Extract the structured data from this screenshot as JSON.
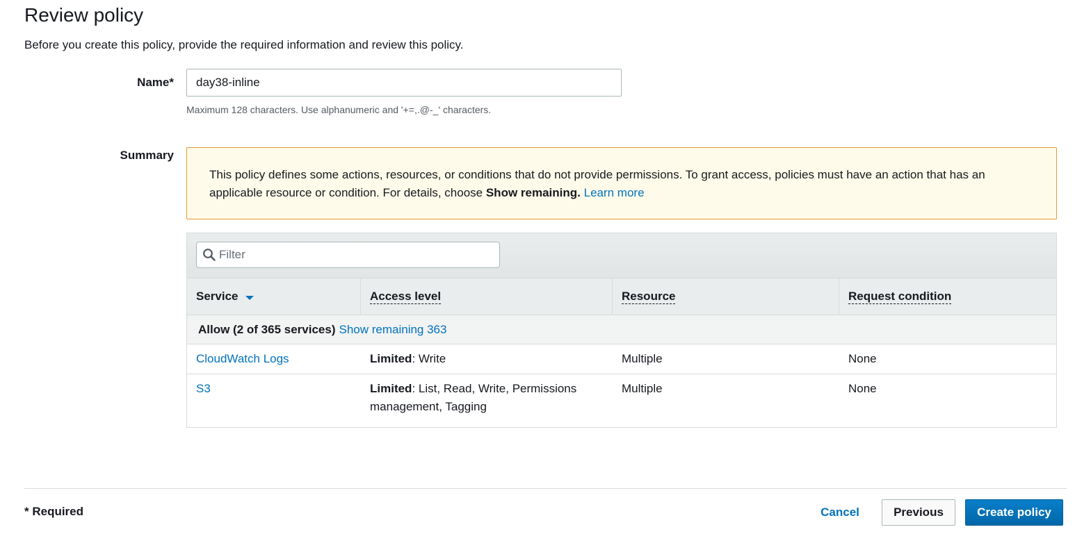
{
  "page": {
    "title": "Review policy",
    "subtitle": "Before you create this policy, provide the required information and review this policy."
  },
  "name_field": {
    "label": "Name*",
    "value": "day38-inline",
    "hint": "Maximum 128 characters. Use alphanumeric and '+=,.@-_' characters."
  },
  "summary": {
    "label": "Summary",
    "alert": {
      "text_before": "This policy defines some actions, resources, or conditions that do not provide permissions. To grant access, policies must have an action that has an applicable resource or condition. For details, choose ",
      "bold_text": "Show remaining.",
      "link_text": "Learn more"
    },
    "filter": {
      "placeholder": "Filter",
      "icon": "search-icon"
    },
    "columns": {
      "service": "Service",
      "access_level": "Access level",
      "resource": "Resource",
      "request_condition": "Request condition"
    },
    "group": {
      "label": "Allow (2 of 365 services)",
      "link": "Show remaining 363"
    },
    "rows": [
      {
        "service": "CloudWatch Logs",
        "access_level_bold": "Limited",
        "access_level_rest": ": Write",
        "resource": "Multiple",
        "request_condition": "None"
      },
      {
        "service": "S3",
        "access_level_bold": "Limited",
        "access_level_rest": ": List, Read, Write, Permissions management, Tagging",
        "resource": "Multiple",
        "request_condition": "None"
      }
    ]
  },
  "footer": {
    "required_note": "* Required",
    "cancel_label": "Cancel",
    "previous_label": "Previous",
    "create_label": "Create policy"
  },
  "colors": {
    "link": "#0073bb",
    "primary_button": "#0073bb",
    "alert_background": "#fffbea",
    "alert_border": "#e59a2e"
  }
}
